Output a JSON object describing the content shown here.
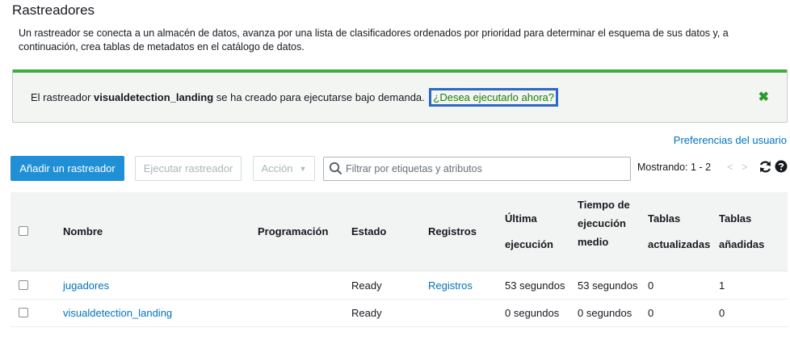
{
  "page": {
    "title": "Rastreadores",
    "description": "Un rastreador se conecta a un almacén de datos, avanza por una lista de clasificadores ordenados por prioridad para determinar el esquema de sus datos y, a continuación, crea tablas de metadatos en el catálogo de datos."
  },
  "flash": {
    "prefix": "El rastreador ",
    "crawler_name": "visualdetection_landing",
    "suffix": " se ha creado para ejecutarse bajo demanda.",
    "link": "¿Desea ejecutarlo ahora?",
    "close_symbol": "✖",
    "accent_color": "#3eae3e"
  },
  "user_prefs_link": "Preferencias del usuario",
  "toolbar": {
    "add_button": "Añadir un rastreador",
    "run_button": "Ejecutar rastreador",
    "action_button": "Acción",
    "action_caret": "▼",
    "search_placeholder": "Filtrar por etiquetas y atributos",
    "showing": "Mostrando: 1 - 2",
    "prev": "<",
    "next": ">"
  },
  "table": {
    "columns": {
      "name": "Nombre",
      "schedule": "Programación",
      "state": "Estado",
      "logs": "Registros",
      "last_run_1": "Última",
      "last_run_2": "ejecución",
      "median_1": "Tiempo de",
      "median_2": "ejecución",
      "median_3": "medio",
      "updated_1": "Tablas",
      "updated_2": "actualizadas",
      "added_1": "Tablas",
      "added_2": "añadidas"
    },
    "rows": [
      {
        "name": "jugadores",
        "schedule": "",
        "state": "Ready",
        "logs": "Registros",
        "last_runtime": "53 segundos",
        "median_runtime": "53 segundos",
        "tables_updated": "0",
        "tables_added": "1"
      },
      {
        "name": "visualdetection_landing",
        "schedule": "",
        "state": "Ready",
        "logs": "",
        "last_runtime": "0 segundos",
        "median_runtime": "0 segundos",
        "tables_updated": "0",
        "tables_added": "0"
      }
    ]
  },
  "colors": {
    "primary_button": "#1f8fd6",
    "link": "#0073bb",
    "highlight_box": "#2d68c4"
  },
  "icons": [
    "search-icon",
    "refresh-icon",
    "help-icon",
    "close-icon"
  ]
}
